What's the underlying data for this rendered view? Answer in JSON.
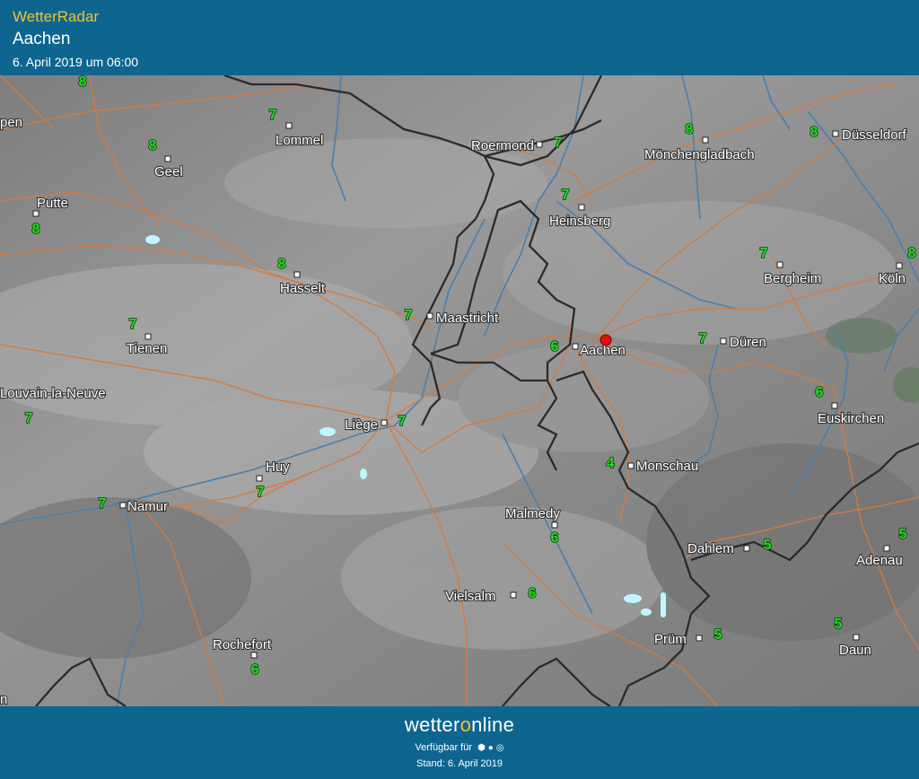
{
  "header": {
    "app_title": "WetterRadar",
    "location": "Aachen",
    "timestamp": "6. April 2019 um 06:00"
  },
  "footer": {
    "brand_pre": "wetter",
    "brand_o": "o",
    "brand_post": "nline",
    "availability": "Verfügbar für",
    "platform_icons": [
      "android-icon",
      "apple-icon",
      "web-icon"
    ],
    "stand": "Stand: 6. April 2019"
  },
  "map": {
    "marker_city": "Aachen",
    "colors": {
      "background": "#0e6690",
      "title": "#f2c12e",
      "temp": "#22dd22",
      "road": "#d87a3a",
      "river": "#4a7fb0",
      "border": "#2b2b2b",
      "marker": "#e01010"
    },
    "cities": [
      {
        "name": "Lommel",
        "temp": "7"
      },
      {
        "name": "Roermond",
        "temp": "7"
      },
      {
        "name": "Mönchengladbach",
        "temp": "8"
      },
      {
        "name": "Düsseldorf",
        "temp": "8"
      },
      {
        "name": "Geel",
        "temp": "8"
      },
      {
        "name": "Putte",
        "temp": "8"
      },
      {
        "name": "Heinsberg",
        "temp": "7"
      },
      {
        "name": "Hasselt",
        "temp": "8"
      },
      {
        "name": "Bergheim",
        "temp": "7"
      },
      {
        "name": "Köln",
        "temp": "8"
      },
      {
        "name": "Maastricht",
        "temp": "7"
      },
      {
        "name": "Tienen",
        "temp": "7"
      },
      {
        "name": "Aachen",
        "temp": "6"
      },
      {
        "name": "Düren",
        "temp": "7"
      },
      {
        "name": "Louvain-la-Neuve",
        "temp": "7"
      },
      {
        "name": "Liège",
        "temp": "7"
      },
      {
        "name": "Euskirchen",
        "temp": "6"
      },
      {
        "name": "Huy",
        "temp": "7"
      },
      {
        "name": "Monschau",
        "temp": "4"
      },
      {
        "name": "Namur",
        "temp": "7"
      },
      {
        "name": "Malmedy",
        "temp": "6"
      },
      {
        "name": "Dahlem",
        "temp": "5"
      },
      {
        "name": "Adenau",
        "temp": "5"
      },
      {
        "name": "Vielsalm",
        "temp": "6"
      },
      {
        "name": "Prüm",
        "temp": "5"
      },
      {
        "name": "Daun",
        "temp": "5"
      },
      {
        "name": "Rochefort",
        "temp": "6"
      }
    ],
    "edge_labels": [
      "pen",
      "n"
    ],
    "edge_temps": [
      "8"
    ]
  }
}
